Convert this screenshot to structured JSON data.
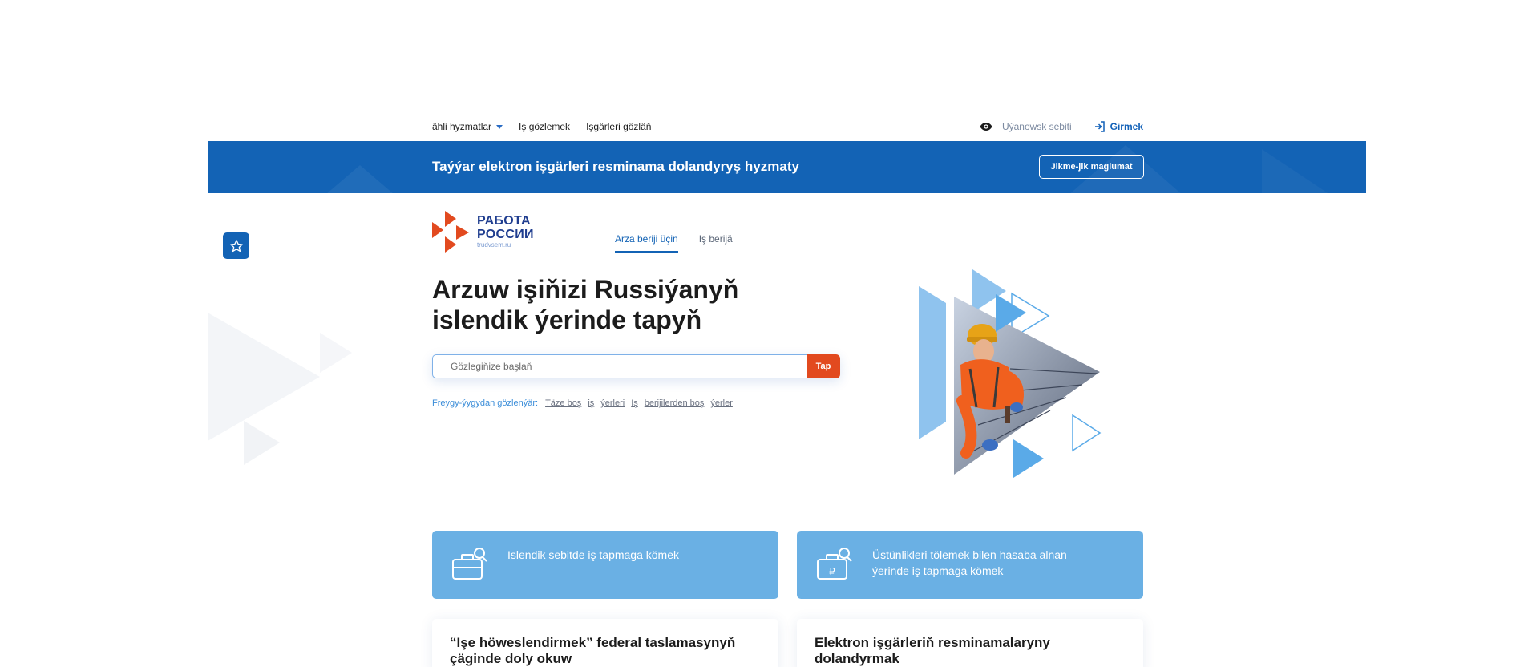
{
  "topnav": {
    "all_services": "ähli hyzmatlar",
    "job_search": "Iş gözlemek",
    "worker_search": "Işgärleri gözläň",
    "vision_mode": "Uýanowsk sebiti",
    "login": "Girmek"
  },
  "banner": {
    "title": "Taýýar elektron işgärleri resminama dolandyryş hyzmaty",
    "button": "Jikme-jik maglumat"
  },
  "logo": {
    "line1": "РАБОТА",
    "line2": "РОССИИ",
    "line3": "trudvsem.ru"
  },
  "tabs": [
    {
      "label": "Arza beriji üçin",
      "active": true
    },
    {
      "label": "Iş berijä",
      "active": false
    }
  ],
  "hero": {
    "title_line1": "Arzuw işiňizi Russiýanyň",
    "title_line2": "islendik ýerinde tapyň"
  },
  "search": {
    "placeholder": "Gözlegiňize başlaň",
    "button": "Tap"
  },
  "frequent": {
    "label": "Freygy-ýygydan gözlenýär:",
    "links": [
      "Täze boş",
      "iş",
      "ýerleri",
      "Iş",
      "berijilerden boş",
      "ýerler"
    ]
  },
  "cards": {
    "blue1": "Islendik sebitde iş tapmaga kömek",
    "blue2_line1": "Üstünlikleri tölemek bilen hasaba alnan",
    "blue2_line2": "ýerinde iş tapmaga kömek",
    "white1_line1": "“Işe höweslendirmek” federal taslamasynyň",
    "white1_line2": "çäginde doly okuw",
    "white2_line1": "Elektron işgärleriň resminamalaryny",
    "white2_line2": "dolandyrmak"
  },
  "colors": {
    "primary": "#1363b5",
    "accent": "#e24a1f",
    "card_blue": "#6ab0e4"
  }
}
